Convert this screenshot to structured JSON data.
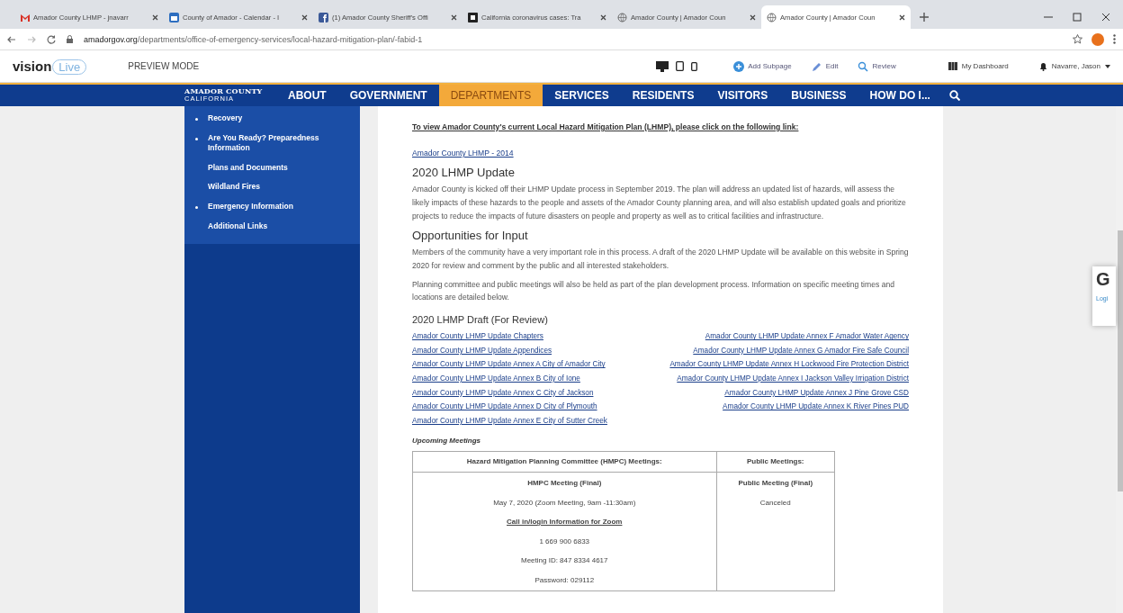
{
  "browser": {
    "tabs": [
      {
        "title": "Amador County LHMP - jnavarr",
        "kind": "mail",
        "selected": false
      },
      {
        "title": "County of Amador - Calendar - I",
        "kind": "calendar",
        "selected": false
      },
      {
        "title": "(1) Amador County Sheriff's Offi",
        "kind": "facebook",
        "selected": false
      },
      {
        "title": "California coronavirus cases: Tra",
        "kind": "news",
        "selected": false
      },
      {
        "title": "Amador County | Amador Coun",
        "kind": "globe",
        "selected": false
      },
      {
        "title": "Amador County | Amador Coun",
        "kind": "globe",
        "selected": true
      }
    ],
    "url": {
      "host": "amadorgov.org",
      "path": "/departments/office-of-emergency-services/local-hazard-mitigation-plan/-fabid-1"
    }
  },
  "cms_toolbar": {
    "logo": {
      "vision": "vision",
      "live": "Live"
    },
    "mode": "PREVIEW MODE",
    "actions": [
      {
        "label": "Add Subpage",
        "kind": "add"
      },
      {
        "label": "Edit",
        "kind": "edit"
      },
      {
        "label": "Review",
        "kind": "review"
      }
    ],
    "dashboard": "My Dashboard",
    "user": "Navarre, Jason"
  },
  "site_nav": {
    "logo": {
      "name": "AMADOR COUNTY",
      "sub": "CALIFORNIA"
    },
    "items": [
      {
        "label": "ABOUT",
        "selected": false
      },
      {
        "label": "GOVERNMENT",
        "selected": false
      },
      {
        "label": "DEPARTMENTS",
        "selected": true
      },
      {
        "label": "SERVICES",
        "selected": false
      },
      {
        "label": "RESIDENTS",
        "selected": false
      },
      {
        "label": "VISITORS",
        "selected": false
      },
      {
        "label": "BUSINESS",
        "selected": false
      },
      {
        "label": "HOW DO I...",
        "selected": false
      }
    ]
  },
  "sidebar": {
    "items": [
      {
        "label": "Recovery",
        "has_children": true
      },
      {
        "label": "Are You Ready? Preparedness Information",
        "has_children": true
      },
      {
        "label": "Plans and Documents",
        "has_children": false
      },
      {
        "label": "Wildland Fires",
        "has_children": false
      },
      {
        "label": "Emergency Information",
        "has_children": true
      },
      {
        "label": "Additional Links",
        "has_children": false
      }
    ]
  },
  "content": {
    "intro_link_text": "To view Amador County's current Local Hazard Mitigation Plan (LHMP), please click on the following link:",
    "current_plan_link": "Amador County LHMP - 2014",
    "sections": [
      {
        "heading": "2020 LHMP Update",
        "paragraphs": [
          "Amador County is kicked off their LHMP Update process in September 2019.  The plan will address an updated list of hazards, will assess the likely impacts of these hazards to the people and assets of the Amador County planning area, and will also establish updated goals and prioritize projects to reduce the impacts of future disasters on people and property as well as to critical facilities and infrastructure."
        ]
      },
      {
        "heading": "Opportunities for Input",
        "paragraphs": [
          "Members of the community have a very important role in this process. A draft of the 2020 LHMP Update will be available on this website in Spring 2020 for review and comment by the public and all interested stakeholders.",
          "Planning committee and public meetings will also be held as part of the plan development process.  Information on specific meeting times and locations are detailed below."
        ]
      }
    ],
    "draft": {
      "heading": "2020 LHMP Draft (For Review)",
      "left_links": [
        "Amador County LHMP Update Chapters",
        "Amador County LHMP Update Appendices",
        "Amador County LHMP Update Annex A City of Amador City",
        "Amador County LHMP Update Annex B City of Ione",
        "Amador County LHMP Update Annex C City of Jackson",
        "Amador County LHMP Update Annex D City of Plymouth",
        "Amador County LHMP Update Annex E City of Sutter Creek"
      ],
      "right_links": [
        "Amador County LHMP Update Annex F Amador Water Agency",
        "Amador County LHMP Update Annex G Amador Fire Safe Council",
        "Amador County LHMP Update Annex H Lockwood Fire Protection District",
        "Amador County LHMP Update Annex I Jackson Valley Irrigation District",
        "Amador County LHMP Update Annex J Pine Grove CSD",
        "Amador County LHMP Update Annex K River Pines PUD"
      ]
    },
    "meetings": {
      "heading": "Upcoming Meetings",
      "columns": [
        "Hazard Mitigation Planning Committee (HMPC) Meetings:",
        "Public Meetings:"
      ],
      "cells": [
        [
          {
            "text": "HMPC Meeting (Final)",
            "kind": "title"
          },
          {
            "text": "May 7, 2020 (Zoom Meeting, 9am -11:30am)",
            "kind": "text"
          },
          {
            "text": "Call in/login Information for Zoom",
            "kind": "link"
          },
          {
            "text": "1 669 900 6833",
            "kind": "text"
          },
          {
            "text": "Meeting ID: 847 8334 4617",
            "kind": "text"
          },
          {
            "text": "Password: 029112",
            "kind": "text"
          }
        ],
        [
          {
            "text": "Public Meeting (Final)",
            "kind": "title"
          },
          {
            "text": "Canceled",
            "kind": "text"
          }
        ]
      ]
    }
  },
  "side_widget": {
    "title": "G",
    "link": "Logi"
  }
}
